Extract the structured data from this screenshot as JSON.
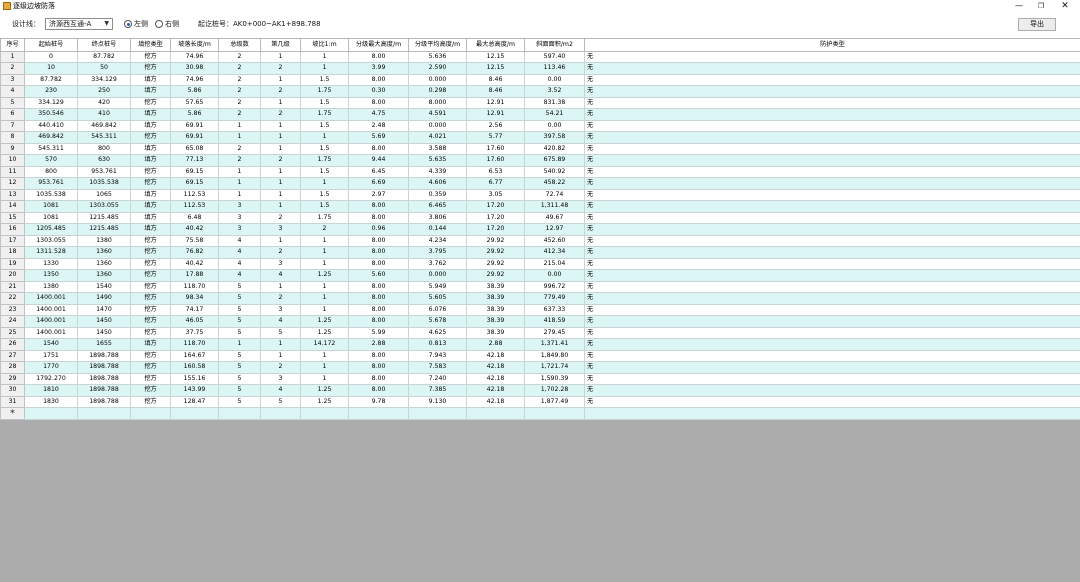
{
  "window": {
    "title": "逐级边坡防落",
    "minimize": "—",
    "maximize": "❐",
    "close": "✕"
  },
  "toolbar": {
    "design_line_label": "设计线：",
    "design_line_value": "济源西互通-A",
    "side_left_label": "左侧",
    "side_right_label": "右侧",
    "station_range_label": "起讫桩号：AK0+000~AK1+898.788",
    "export_label": "导出"
  },
  "table": {
    "columns": [
      "序号",
      "起始桩号",
      "终点桩号",
      "填挖类型",
      "坡落长度/m",
      "总级数",
      "第几级",
      "坡比1:m",
      "分级最大高度/m",
      "分级平均高度/m",
      "最大总高度/m",
      "斜面面积/m2",
      "防护类型"
    ],
    "new_row_marker": "＊",
    "rows": [
      [
        "1",
        "0",
        "87.782",
        "挖方",
        "74.96",
        "2",
        "1",
        "1",
        "8.00",
        "5.636",
        "12.15",
        "597.40",
        "无"
      ],
      [
        "2",
        "10",
        "50",
        "挖方",
        "30.98",
        "2",
        "2",
        "1",
        "3.99",
        "2.590",
        "12.15",
        "113.46",
        "无"
      ],
      [
        "3",
        "87.782",
        "334.129",
        "填方",
        "74.96",
        "2",
        "1",
        "1.5",
        "8.00",
        "0.000",
        "8.46",
        "0.00",
        "无"
      ],
      [
        "4",
        "230",
        "250",
        "填方",
        "5.86",
        "2",
        "2",
        "1.75",
        "0.30",
        "0.298",
        "8.46",
        "3.52",
        "无"
      ],
      [
        "5",
        "334.129",
        "420",
        "挖方",
        "57.65",
        "2",
        "1",
        "1.5",
        "8.00",
        "8.000",
        "12.91",
        "831.38",
        "无"
      ],
      [
        "6",
        "350.546",
        "410",
        "填方",
        "5.86",
        "2",
        "2",
        "1.75",
        "4.75",
        "4.591",
        "12.91",
        "54.21",
        "无"
      ],
      [
        "7",
        "440.410",
        "469.842",
        "填方",
        "69.91",
        "1",
        "1",
        "1.5",
        "2.48",
        "0.000",
        "2.56",
        "0.00",
        "无"
      ],
      [
        "8",
        "469.842",
        "545.311",
        "挖方",
        "69.91",
        "1",
        "1",
        "1",
        "5.69",
        "4.021",
        "5.77",
        "397.58",
        "无"
      ],
      [
        "9",
        "545.311",
        "800",
        "填方",
        "65.08",
        "2",
        "1",
        "1.5",
        "8.00",
        "3.588",
        "17.60",
        "420.82",
        "无"
      ],
      [
        "10",
        "570",
        "630",
        "填方",
        "77.13",
        "2",
        "2",
        "1.75",
        "9.44",
        "5.635",
        "17.60",
        "675.89",
        "无"
      ],
      [
        "11",
        "800",
        "953.761",
        "挖方",
        "69.15",
        "1",
        "1",
        "1.5",
        "6.45",
        "4.339",
        "6.53",
        "540.92",
        "无"
      ],
      [
        "12",
        "953.761",
        "1035.538",
        "挖方",
        "69.15",
        "1",
        "1",
        "1",
        "6.69",
        "4.606",
        "6.77",
        "458.22",
        "无"
      ],
      [
        "13",
        "1035.538",
        "1065",
        "填方",
        "112.53",
        "1",
        "1",
        "1.5",
        "2.97",
        "0.359",
        "3.05",
        "72.74",
        "无"
      ],
      [
        "14",
        "1081",
        "1303.055",
        "填方",
        "112.53",
        "3",
        "1",
        "1.5",
        "8.00",
        "6.465",
        "17.20",
        "1,311.48",
        "无"
      ],
      [
        "15",
        "1081",
        "1215.485",
        "填方",
        "6.48",
        "3",
        "2",
        "1.75",
        "8.00",
        "3.806",
        "17.20",
        "49.67",
        "无"
      ],
      [
        "16",
        "1205.485",
        "1215.485",
        "填方",
        "40.42",
        "3",
        "3",
        "2",
        "0.96",
        "0.144",
        "17.20",
        "12.97",
        "无"
      ],
      [
        "17",
        "1303.055",
        "1380",
        "挖方",
        "75.58",
        "4",
        "1",
        "1",
        "8.00",
        "4.234",
        "29.92",
        "452.60",
        "无"
      ],
      [
        "18",
        "1311.528",
        "1360",
        "挖方",
        "76.82",
        "4",
        "2",
        "1",
        "8.00",
        "3.795",
        "29.92",
        "412.34",
        "无"
      ],
      [
        "19",
        "1330",
        "1360",
        "挖方",
        "40.42",
        "4",
        "3",
        "1",
        "8.00",
        "3.762",
        "29.92",
        "215.04",
        "无"
      ],
      [
        "20",
        "1350",
        "1360",
        "挖方",
        "17.88",
        "4",
        "4",
        "1.25",
        "5.60",
        "0.000",
        "29.92",
        "0.00",
        "无"
      ],
      [
        "21",
        "1380",
        "1540",
        "挖方",
        "118.70",
        "5",
        "1",
        "1",
        "8.00",
        "5.949",
        "38.39",
        "996.72",
        "无"
      ],
      [
        "22",
        "1400.001",
        "1490",
        "挖方",
        "98.34",
        "5",
        "2",
        "1",
        "8.00",
        "5.605",
        "38.39",
        "779.49",
        "无"
      ],
      [
        "23",
        "1400.001",
        "1470",
        "挖方",
        "74.17",
        "5",
        "3",
        "1",
        "8.00",
        "6.076",
        "38.39",
        "637.33",
        "无"
      ],
      [
        "24",
        "1400.001",
        "1450",
        "挖方",
        "46.05",
        "5",
        "4",
        "1.25",
        "8.00",
        "5.678",
        "38.39",
        "418.59",
        "无"
      ],
      [
        "25",
        "1400.001",
        "1450",
        "挖方",
        "37.75",
        "5",
        "5",
        "1.25",
        "5.99",
        "4.625",
        "38.39",
        "279.45",
        "无"
      ],
      [
        "26",
        "1540",
        "1655",
        "填方",
        "118.70",
        "1",
        "1",
        "14.172",
        "2.88",
        "0.813",
        "2.88",
        "1,371.41",
        "无"
      ],
      [
        "27",
        "1751",
        "1898.788",
        "挖方",
        "164.67",
        "5",
        "1",
        "1",
        "8.00",
        "7.943",
        "42.18",
        "1,849.80",
        "无"
      ],
      [
        "28",
        "1770",
        "1898.788",
        "挖方",
        "160.58",
        "5",
        "2",
        "1",
        "8.00",
        "7.583",
        "42.18",
        "1,721.74",
        "无"
      ],
      [
        "29",
        "1792.270",
        "1898.788",
        "挖方",
        "155.16",
        "5",
        "3",
        "1",
        "8.00",
        "7.240",
        "42.18",
        "1,590.39",
        "无"
      ],
      [
        "30",
        "1810",
        "1898.788",
        "挖方",
        "143.99",
        "5",
        "4",
        "1.25",
        "8.00",
        "7.385",
        "42.18",
        "1,702.28",
        "无"
      ],
      [
        "31",
        "1830",
        "1898.788",
        "挖方",
        "128.47",
        "5",
        "5",
        "1.25",
        "9.78",
        "9.130",
        "42.18",
        "1,877.49",
        "无"
      ]
    ]
  }
}
